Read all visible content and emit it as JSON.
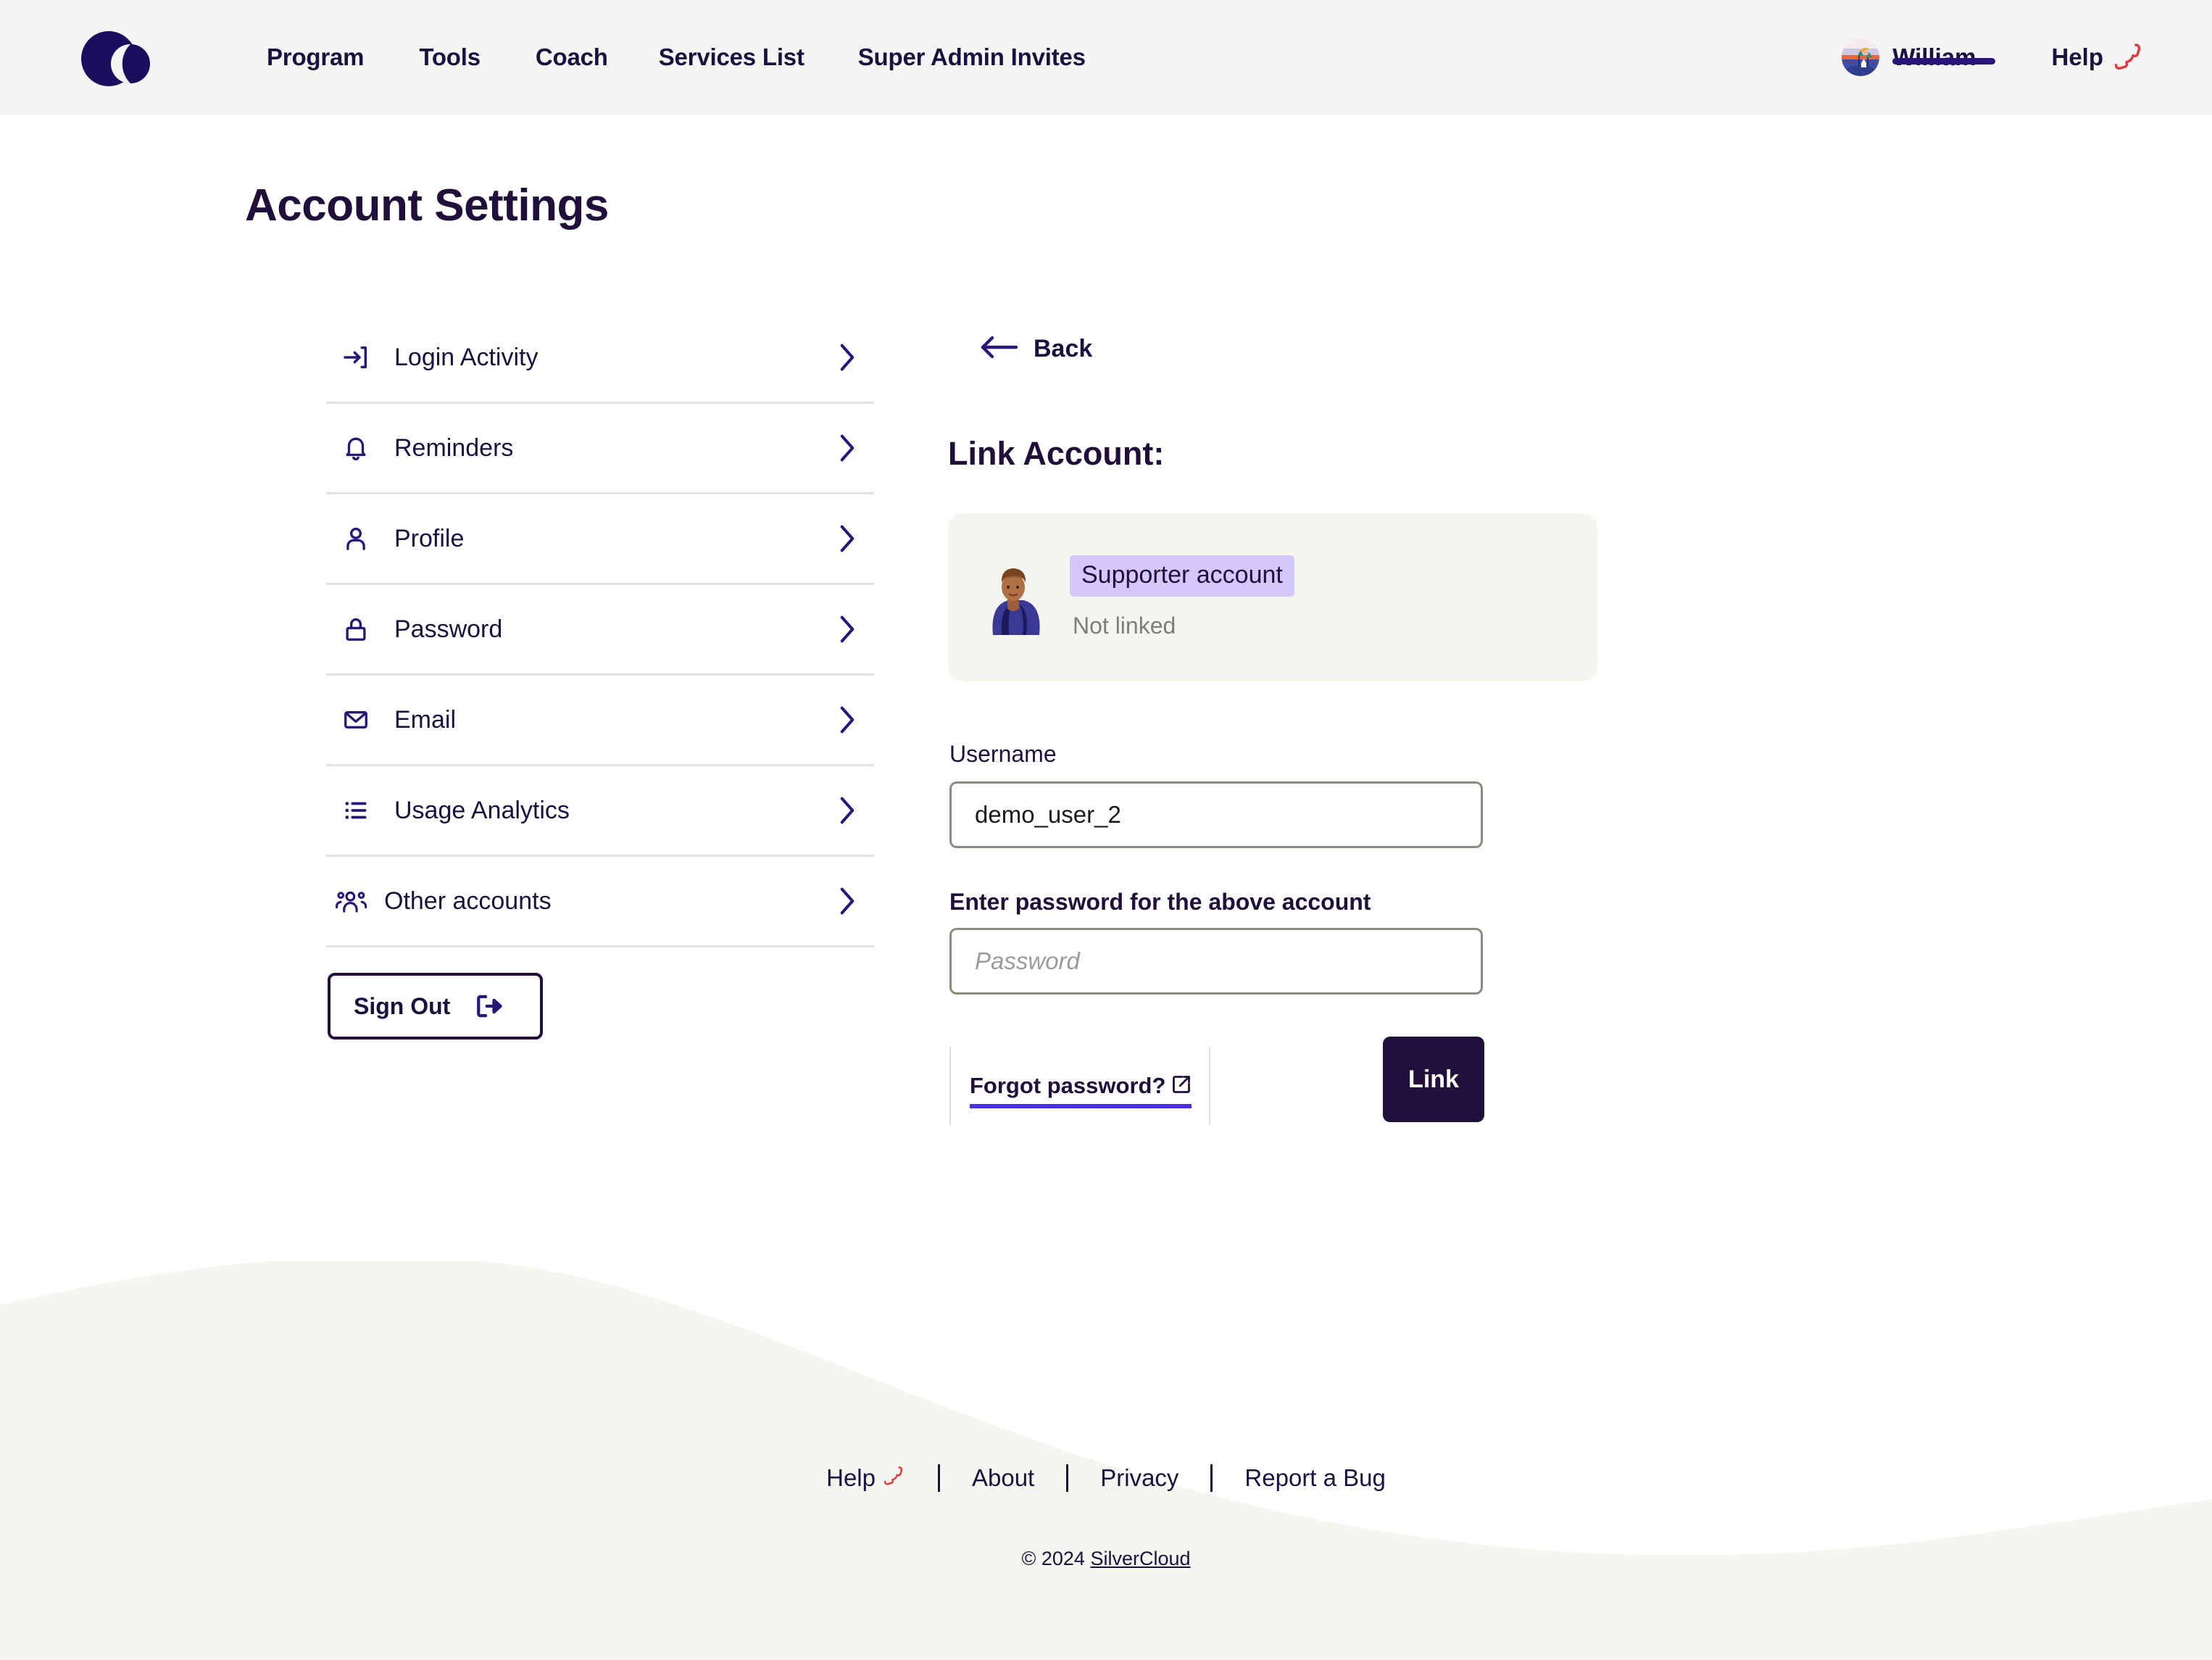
{
  "header": {
    "logo_name": "silvercloud-logo",
    "nav": [
      {
        "label": "Program"
      },
      {
        "label": "Tools"
      },
      {
        "label": "Coach"
      },
      {
        "label": "Services List"
      },
      {
        "label": "Super Admin Invites"
      }
    ],
    "user": {
      "name": "William",
      "avatar_name": "user-avatar-landscape"
    },
    "help": {
      "label": "Help",
      "icon": "phone-icon"
    }
  },
  "page": {
    "title": "Account Settings"
  },
  "sidebar": {
    "items": [
      {
        "label": "Login Activity",
        "icon": "login-arrow-icon"
      },
      {
        "label": "Reminders",
        "icon": "bell-icon"
      },
      {
        "label": "Profile",
        "icon": "person-icon"
      },
      {
        "label": "Password",
        "icon": "lock-icon"
      },
      {
        "label": "Email",
        "icon": "envelope-icon"
      },
      {
        "label": "Usage Analytics",
        "icon": "list-icon"
      },
      {
        "label": "Other accounts",
        "icon": "people-icon"
      }
    ],
    "sign_out": {
      "label": "Sign Out",
      "icon": "sign-out-icon"
    }
  },
  "main": {
    "back": {
      "label": "Back",
      "icon": "arrow-left-icon"
    },
    "title": "Link Account:",
    "account_card": {
      "avatar_name": "supporter-avatar-illustration",
      "badge": "Supporter account",
      "status": "Not linked"
    },
    "username": {
      "label": "Username",
      "value": "demo_user_2"
    },
    "password": {
      "label": "Enter password for the above account",
      "placeholder": "Password",
      "value": ""
    },
    "forgot_password": {
      "label": "Forgot password?",
      "icon": "external-link-icon"
    },
    "link_button": {
      "label": "Link"
    }
  },
  "footer": {
    "links": [
      {
        "label": "Help",
        "icon": "phone-icon"
      },
      {
        "label": "About",
        "icon": ""
      },
      {
        "label": "Privacy",
        "icon": ""
      },
      {
        "label": "Report a Bug",
        "icon": ""
      }
    ],
    "copyright_prefix": "© 2024 ",
    "copyright_brand": "SilverCloud"
  },
  "colors": {
    "brand_navy": "#200f3b",
    "accent_indigo": "#2a1579",
    "badge_lavender": "#d6c7fa",
    "help_red": "#e23b3b",
    "header_bg": "#f5f5f3",
    "wave_bg": "#f5f6ef",
    "card_bg": "#f5f5ef"
  }
}
